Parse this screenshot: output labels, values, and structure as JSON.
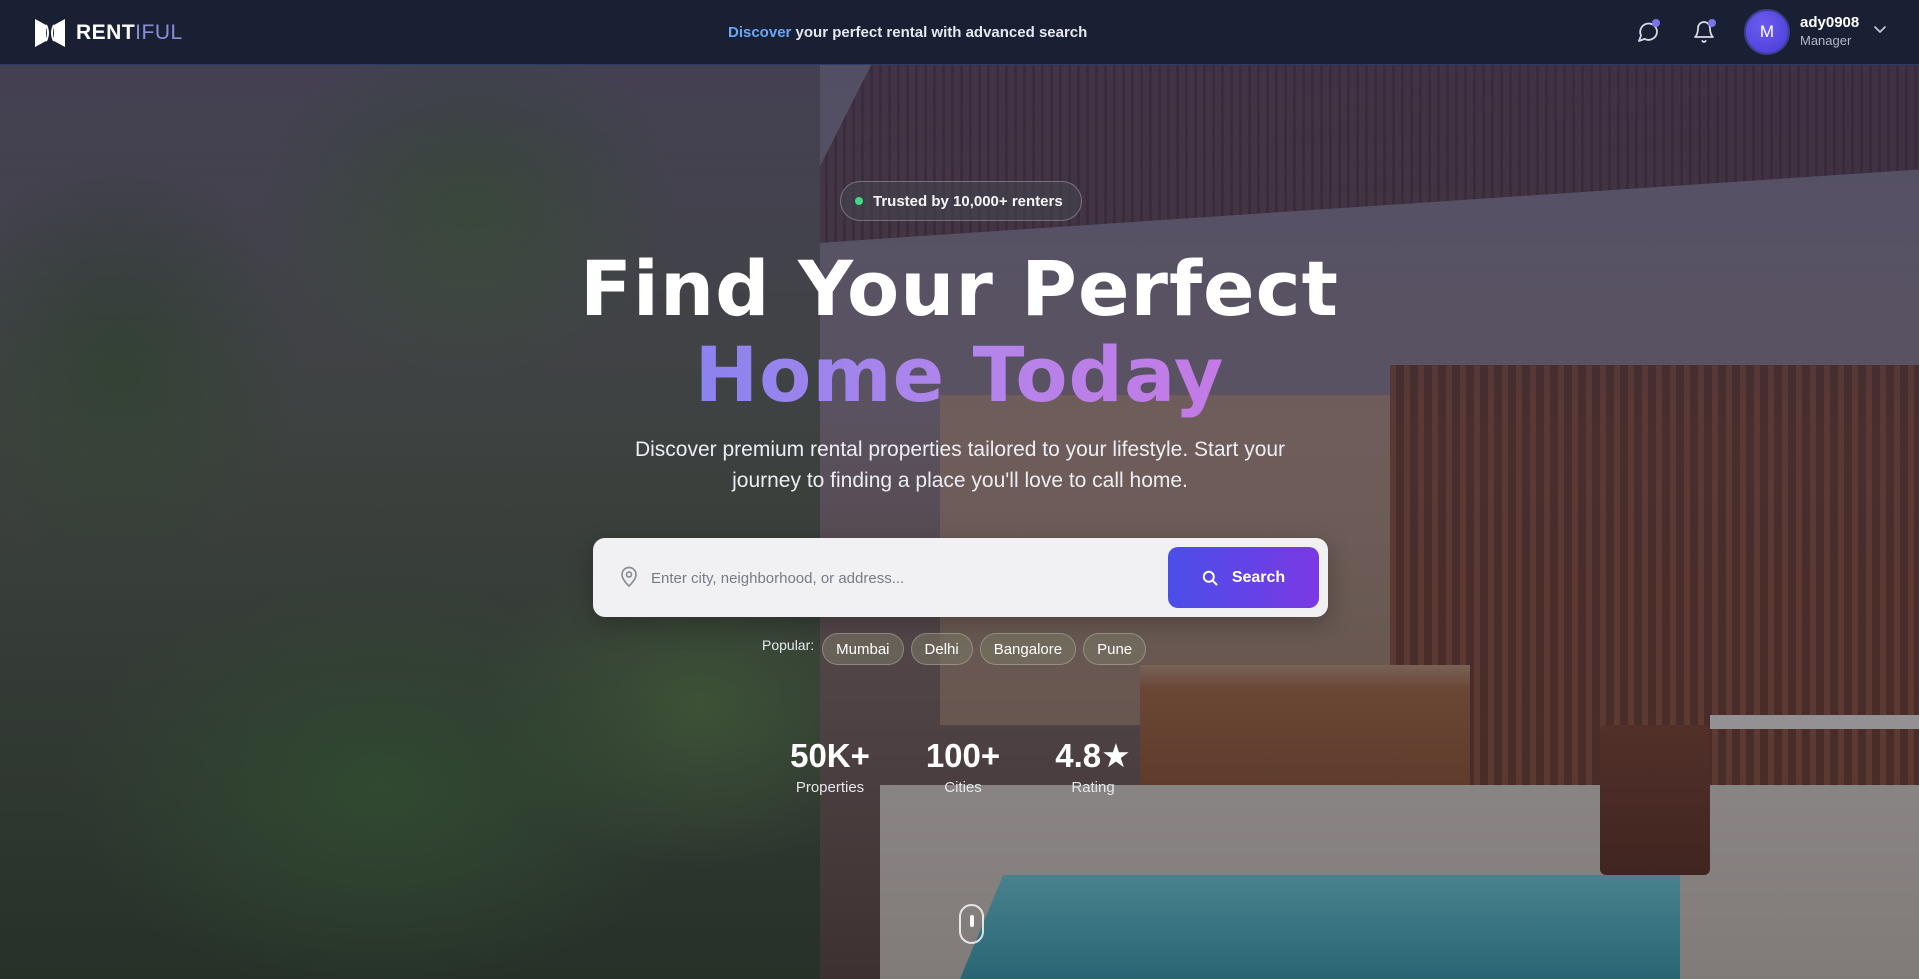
{
  "nav": {
    "brand_main": "RENT",
    "brand_suffix": "IFUL",
    "tagline_highlight": "Discover",
    "tagline_rest": " your perfect rental with advanced search",
    "icons": [
      "chat-icon",
      "bell-icon"
    ],
    "user": {
      "initial": "M",
      "name": "ady0908",
      "role": "Manager"
    }
  },
  "hero": {
    "badge": "Trusted by 10,000+ renters",
    "title_line1": "Find Your Perfect",
    "title_line2": "Home Today",
    "subtitle": "Discover premium rental properties tailored to your lifestyle. Start your journey to finding a place you'll love to call home.",
    "search": {
      "placeholder": "Enter city, neighborhood, or address...",
      "button_label": "Search"
    },
    "popular_label": "Popular:",
    "popular_cities": [
      "Mumbai",
      "Delhi",
      "Bangalore",
      "Pune"
    ],
    "stats": [
      {
        "value": "50K+",
        "label": "Properties"
      },
      {
        "value": "100+",
        "label": "Cities"
      },
      {
        "value": "4.8★",
        "label": "Rating"
      }
    ]
  },
  "colors": {
    "nav_bg": "#1a2034",
    "accent_blue": "#6aa6f5",
    "button_gradient_start": "#4b4ee9",
    "button_gradient_end": "#7a39e4",
    "title_gradient_start": "#8a83ee",
    "title_gradient_end": "#c47ae6",
    "status_green": "#3ddc84"
  }
}
